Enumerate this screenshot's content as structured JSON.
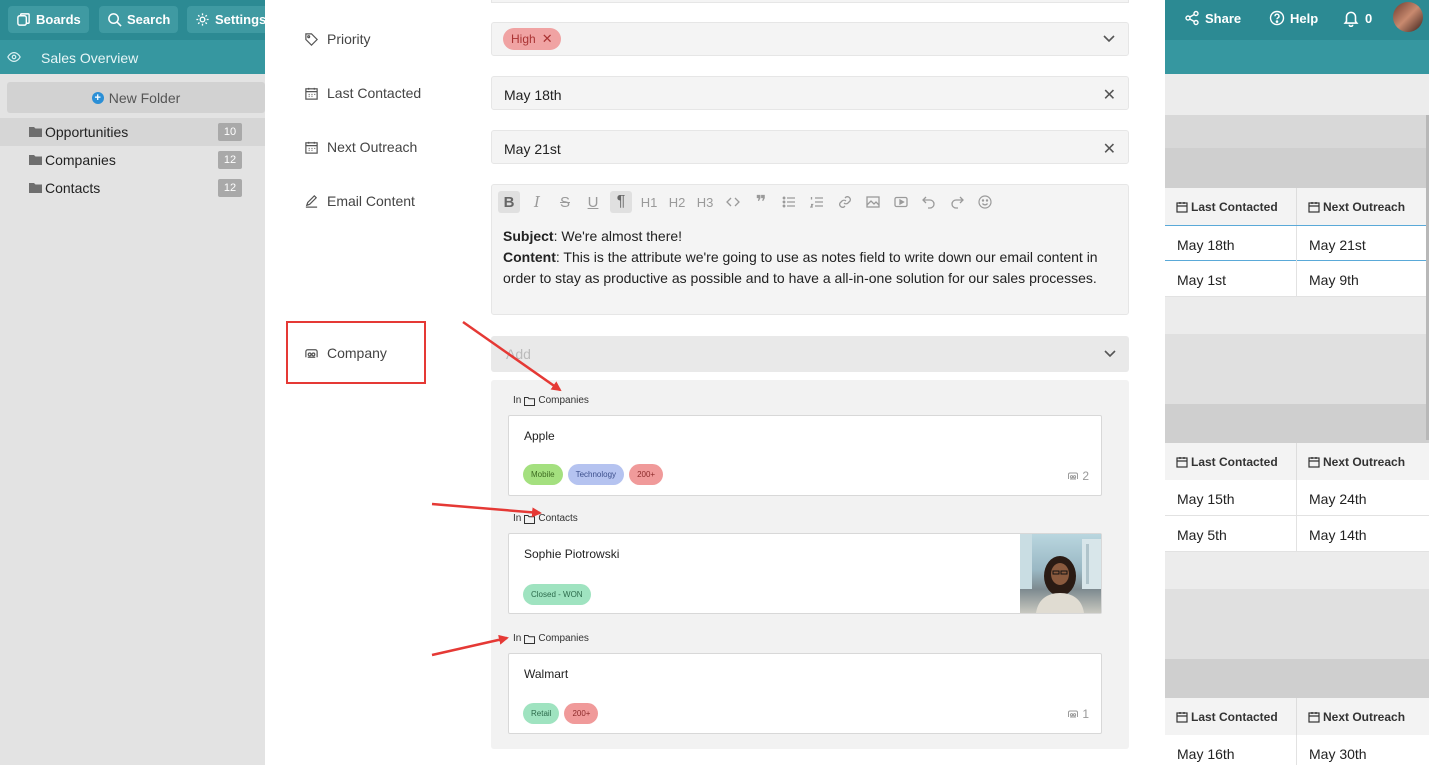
{
  "topbar": {
    "boards_label": "Boards",
    "search_label": "Search",
    "settings_label": "Settings",
    "share_label": "Share",
    "help_label": "Help",
    "notifications_count": "0"
  },
  "subbar": {
    "title": "Sales Overview"
  },
  "sidebar": {
    "new_folder_label": "New Folder",
    "folders": [
      {
        "label": "Opportunities",
        "count": "10"
      },
      {
        "label": "Companies",
        "count": "12"
      },
      {
        "label": "Contacts",
        "count": "12"
      }
    ]
  },
  "right_table": {
    "col1": "Last Contacted",
    "col2": "Next Outreach",
    "groups": [
      {
        "rows": [
          {
            "c1": "May 18th",
            "c2": "May 21st"
          },
          {
            "c1": "May 1st",
            "c2": "May 9th"
          }
        ]
      },
      {
        "rows": [
          {
            "c1": "May 15th",
            "c2": "May 24th"
          },
          {
            "c1": "May 5th",
            "c2": "May 14th"
          }
        ]
      },
      {
        "rows": [
          {
            "c1": "May 16th",
            "c2": "May 30th"
          }
        ]
      }
    ]
  },
  "form": {
    "priority": {
      "label": "Priority",
      "tag": "High"
    },
    "last_contacted": {
      "label": "Last Contacted",
      "value": "May 18th"
    },
    "next_outreach": {
      "label": "Next Outreach",
      "value": "May 21st"
    },
    "email": {
      "label": "Email Content",
      "toolbar_h1": "H1",
      "toolbar_h2": "H2",
      "toolbar_h3": "H3",
      "subject_label": "Subject",
      "subject_text": ": We're almost there!",
      "content_label": "Content",
      "content_text": ": This is the attribute we're going to use as notes field to write down our email content in order to stay as productive as possible and to have a all-in-one solution for our sales processes."
    },
    "company": {
      "label": "Company",
      "placeholder": "Add"
    }
  },
  "linked": {
    "in_word": "In",
    "items": [
      {
        "folder": "Companies",
        "name": "Apple",
        "tags": [
          "Mobile",
          "Technology",
          "200+"
        ],
        "count": "2"
      },
      {
        "folder": "Contacts",
        "name": "Sophie Piotrowski",
        "tags": [
          "Closed - WON"
        ]
      },
      {
        "folder": "Companies",
        "name": "Walmart",
        "tags": [
          "Retail",
          "200+"
        ],
        "count": "1"
      }
    ]
  },
  "colors": {
    "topbar": "#2c8a93",
    "tag_green": "#a4e07f",
    "tag_blue": "#b5c3f0",
    "tag_red": "#f09a9a",
    "tag_teal": "#9fe3c0",
    "annotation_red": "#e53935"
  }
}
